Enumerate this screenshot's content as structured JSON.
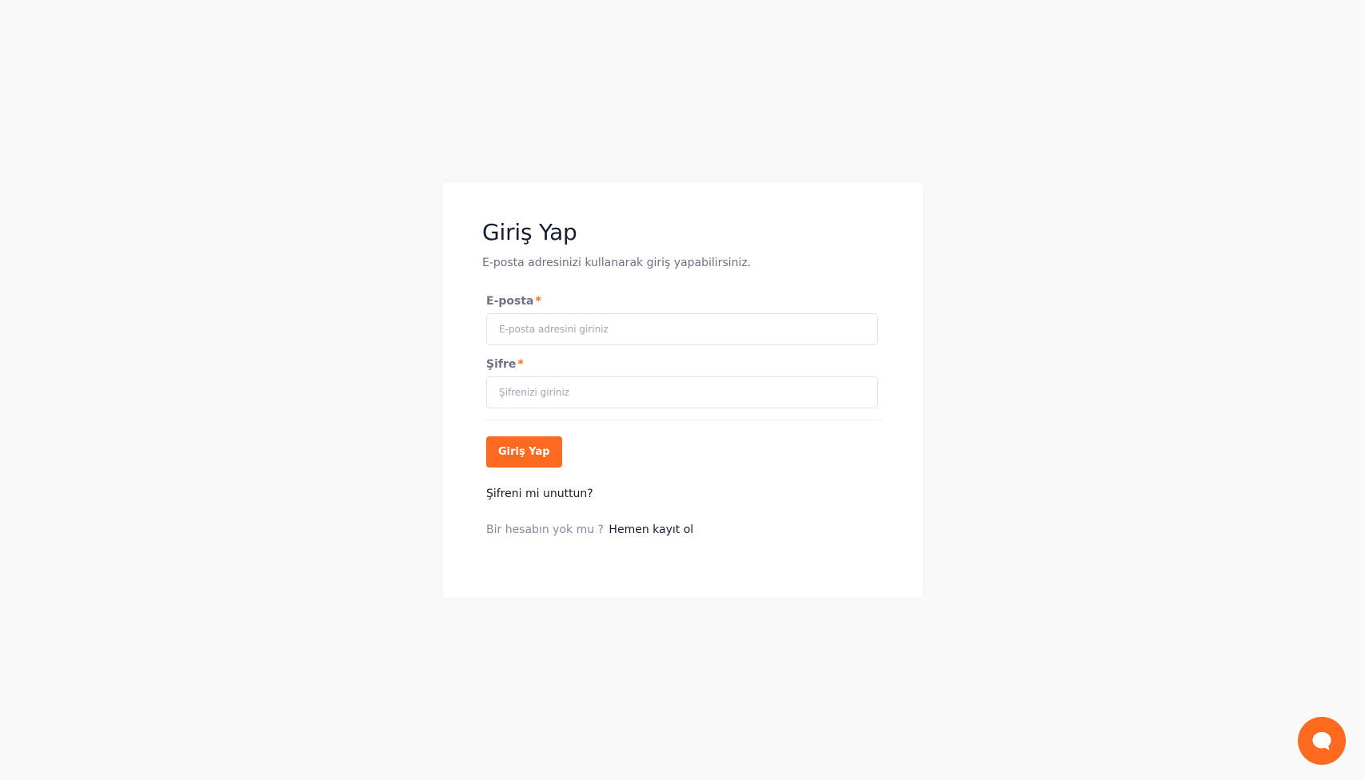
{
  "login": {
    "title": "Giriş Yap",
    "subtitle": "E-posta adresinizi kullanarak giriş yapabilirsiniz.",
    "email": {
      "label": "E-posta",
      "required_mark": "*",
      "placeholder": "E-posta adresini giriniz",
      "value": ""
    },
    "password": {
      "label": "Şifre",
      "required_mark": "*",
      "placeholder": "Şifrenizi giriniz",
      "value": ""
    },
    "submit_label": "Giriş Yap",
    "forgot_label": "Şifreni mi unuttun?",
    "signup_question": "Bir hesabın yok mu ?",
    "signup_link": "Hemen kayıt ol"
  },
  "chat": {
    "icon": "chat-bubble-icon"
  },
  "colors": {
    "accent": "#fe6a1f",
    "background": "#f9f9f9",
    "heading": "#181c32",
    "muted": "#6e6f87"
  }
}
